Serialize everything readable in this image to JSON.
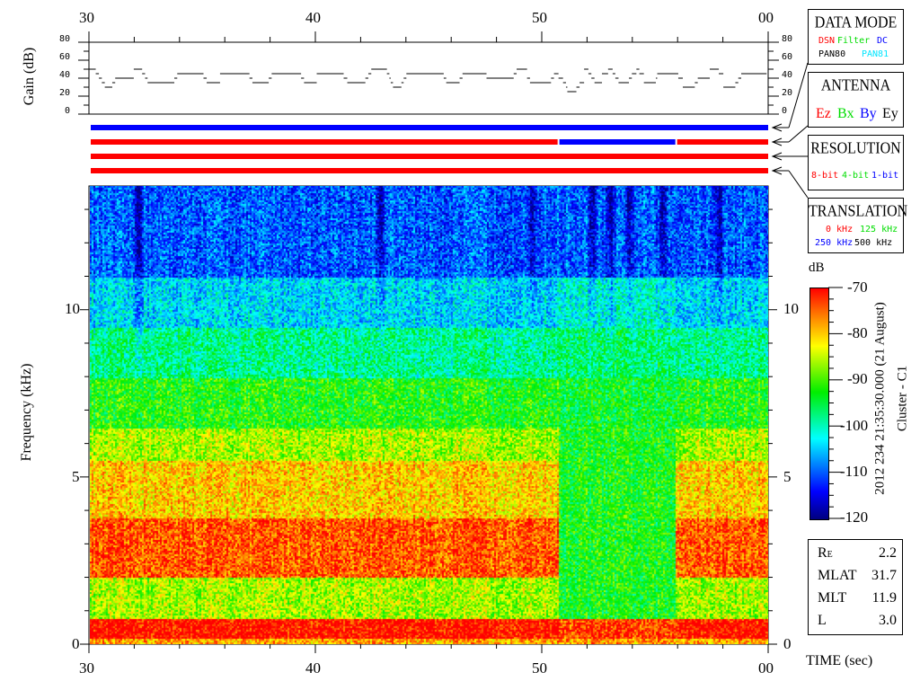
{
  "chart_data": [
    {
      "type": "line",
      "name": "gain",
      "ylabel": "Gain (dB)",
      "ylim": [
        0,
        80
      ],
      "yticks": [
        "0",
        "20",
        "40",
        "60",
        "80"
      ],
      "xlim": [
        30,
        60
      ],
      "xticks": [
        "30",
        "40",
        "50",
        "00"
      ],
      "steps": [
        [
          30.0,
          50
        ],
        [
          30.3,
          45
        ],
        [
          30.44,
          40
        ],
        [
          30.57,
          35
        ],
        [
          30.7,
          30
        ],
        [
          31.03,
          35
        ],
        [
          31.16,
          40
        ],
        [
          31.98,
          50
        ],
        [
          32.35,
          45
        ],
        [
          32.48,
          40
        ],
        [
          32.59,
          35
        ],
        [
          33.77,
          40
        ],
        [
          33.9,
          45
        ],
        [
          35.06,
          40
        ],
        [
          35.2,
          35
        ],
        [
          35.79,
          45
        ],
        [
          37.09,
          40
        ],
        [
          37.22,
          35
        ],
        [
          37.94,
          40
        ],
        [
          38.07,
          45
        ],
        [
          39.37,
          40
        ],
        [
          39.5,
          35
        ],
        [
          40.06,
          45
        ],
        [
          41.25,
          40
        ],
        [
          41.41,
          35
        ],
        [
          42.21,
          40
        ],
        [
          42.34,
          45
        ],
        [
          42.47,
          50
        ],
        [
          43.16,
          45
        ],
        [
          43.27,
          40
        ],
        [
          43.33,
          35
        ],
        [
          43.43,
          30
        ],
        [
          43.8,
          35
        ],
        [
          43.9,
          40
        ],
        [
          44.02,
          45
        ],
        [
          45.67,
          40
        ],
        [
          45.78,
          35
        ],
        [
          46.37,
          40
        ],
        [
          46.5,
          45
        ],
        [
          47.56,
          40
        ],
        [
          48.76,
          45
        ],
        [
          48.89,
          50
        ],
        [
          49.35,
          40
        ],
        [
          49.48,
          35
        ],
        [
          50.41,
          40
        ],
        [
          50.54,
          45
        ],
        [
          50.74,
          40
        ],
        [
          50.94,
          35
        ],
        [
          51.07,
          30
        ],
        [
          51.13,
          25
        ],
        [
          51.53,
          30
        ],
        [
          51.67,
          35
        ],
        [
          51.87,
          50
        ],
        [
          52.06,
          45
        ],
        [
          52.19,
          40
        ],
        [
          52.33,
          35
        ],
        [
          52.66,
          45
        ],
        [
          52.93,
          50
        ],
        [
          53.13,
          45
        ],
        [
          53.25,
          40
        ],
        [
          53.39,
          35
        ],
        [
          53.85,
          40
        ],
        [
          53.98,
          45
        ],
        [
          54.18,
          50
        ],
        [
          54.31,
          45
        ],
        [
          54.51,
          35
        ],
        [
          55.04,
          40
        ],
        [
          55.1,
          45
        ],
        [
          56.03,
          40
        ],
        [
          56.23,
          30
        ],
        [
          56.76,
          35
        ],
        [
          56.89,
          40
        ],
        [
          57.42,
          50
        ],
        [
          57.82,
          45
        ],
        [
          58.02,
          30
        ],
        [
          58.55,
          35
        ],
        [
          58.68,
          40
        ],
        [
          58.81,
          45
        ],
        [
          59.93,
          45
        ]
      ]
    },
    {
      "type": "heatmap",
      "name": "spectrogram",
      "xlabel": "TIME (sec)",
      "ylabel": "Frequency (kHz)",
      "xlim": [
        30,
        60
      ],
      "ylim": [
        0,
        13.7
      ],
      "xticks": [
        "30",
        "40",
        "50",
        "00"
      ],
      "yticks": [
        "0",
        "5",
        "10"
      ],
      "colorbar": {
        "label": "dB",
        "range": [
          -120,
          -70
        ],
        "ticks": [
          "-70",
          "-80",
          "-90",
          "-100",
          "-110",
          "-120"
        ]
      },
      "freq_edges_khz": [
        0,
        0.2,
        0.8,
        2.0,
        3.8,
        5.5,
        6.5,
        8.0,
        9.5,
        11.0,
        13.7
      ],
      "profiles": [
        {
          "time_range": [
            30,
            50.7
          ],
          "db": [
            -78,
            -70,
            -86,
            -74,
            -80,
            -86,
            -92,
            -98,
            -104,
            -110
          ]
        },
        {
          "time_range": [
            50.7,
            55.9
          ],
          "db": [
            -78,
            -73,
            -93,
            -93,
            -93,
            -93,
            -94,
            -97,
            -101,
            -110
          ]
        },
        {
          "time_range": [
            55.9,
            60
          ],
          "db": [
            -78,
            -70,
            -86,
            -74,
            -80,
            -86,
            -92,
            -98,
            -104,
            -110
          ]
        }
      ],
      "dark_streak_times": [
        32.1,
        42.8,
        49.5,
        52.2,
        53.0,
        53.8,
        55.3,
        57.8
      ]
    }
  ],
  "axes": {
    "top_time_labels": [
      "30",
      "40",
      "50",
      "00"
    ],
    "bottom_time_labels": [
      "30",
      "40",
      "50",
      "00"
    ],
    "freq_labels_left": [
      "0",
      "5",
      "10"
    ],
    "freq_labels_right": [
      "0",
      "5",
      "10"
    ],
    "gain_labels_left": [
      "0",
      "20",
      "40",
      "60",
      "80"
    ],
    "gain_labels_right": [
      "0",
      "20",
      "40",
      "60",
      "80"
    ],
    "gain_axis_title": "Gain (dB)",
    "freq_axis_title": "Frequency (kHz)",
    "time_axis_title": "TIME (sec)"
  },
  "status_bars": [
    {
      "name": "data-mode",
      "segments": [
        [
          30,
          60,
          "#0000ff"
        ]
      ]
    },
    {
      "name": "antenna",
      "segments": [
        [
          30,
          50.7,
          "#ff0000"
        ],
        [
          50.7,
          55.9,
          "#0000ff"
        ],
        [
          55.9,
          60,
          "#ff0000"
        ]
      ]
    },
    {
      "name": "resolution",
      "segments": [
        [
          30,
          60,
          "#ff0000"
        ]
      ]
    },
    {
      "name": "translation",
      "segments": [
        [
          30,
          60,
          "#ff0000"
        ]
      ]
    }
  ],
  "legend": {
    "data_mode": {
      "title": "DATA MODE",
      "items": [
        {
          "label": "DSN",
          "color": "#ff0000"
        },
        {
          "label": "Filter",
          "color": "#00dd00"
        },
        {
          "label": "DC",
          "color": "#0000ff"
        },
        {
          "label": "PAN80",
          "color": "#000000"
        },
        {
          "label": "PAN81",
          "color": "#00e5ff"
        }
      ]
    },
    "antenna": {
      "title": "ANTENNA",
      "items": [
        {
          "label": "Ez",
          "color": "#ff0000"
        },
        {
          "label": "Bx",
          "color": "#00dd00"
        },
        {
          "label": "By",
          "color": "#0000ff"
        },
        {
          "label": "Ey",
          "color": "#000000"
        }
      ]
    },
    "resolution": {
      "title": "RESOLUTION",
      "items": [
        {
          "label": "8-bit",
          "color": "#ff0000"
        },
        {
          "label": "4-bit",
          "color": "#00dd00"
        },
        {
          "label": "1-bit",
          "color": "#0000ff"
        }
      ]
    },
    "translation": {
      "title": "TRANSLATION",
      "items": [
        {
          "label": "0 kHz",
          "color": "#ff0000"
        },
        {
          "label": "125 kHz",
          "color": "#00dd00"
        },
        {
          "label": "250 kHz",
          "color": "#0000ff"
        },
        {
          "label": "500 kHz",
          "color": "#000000"
        }
      ]
    }
  },
  "colorbar_title": "dB",
  "colorbar_labels": [
    "-70",
    "-80",
    "-90",
    "-100",
    "-110",
    "-120"
  ],
  "timestamp": "2012 234 21:35:30.000 (21 August)",
  "spacecraft": "Cluster - C1",
  "info": [
    {
      "key": "R",
      "sub": "E",
      "value": "2.2"
    },
    {
      "key": "MLAT",
      "sub": "",
      "value": "31.7"
    },
    {
      "key": "MLT",
      "sub": "",
      "value": "11.9"
    },
    {
      "key": "L",
      "sub": "",
      "value": "3.0"
    }
  ]
}
